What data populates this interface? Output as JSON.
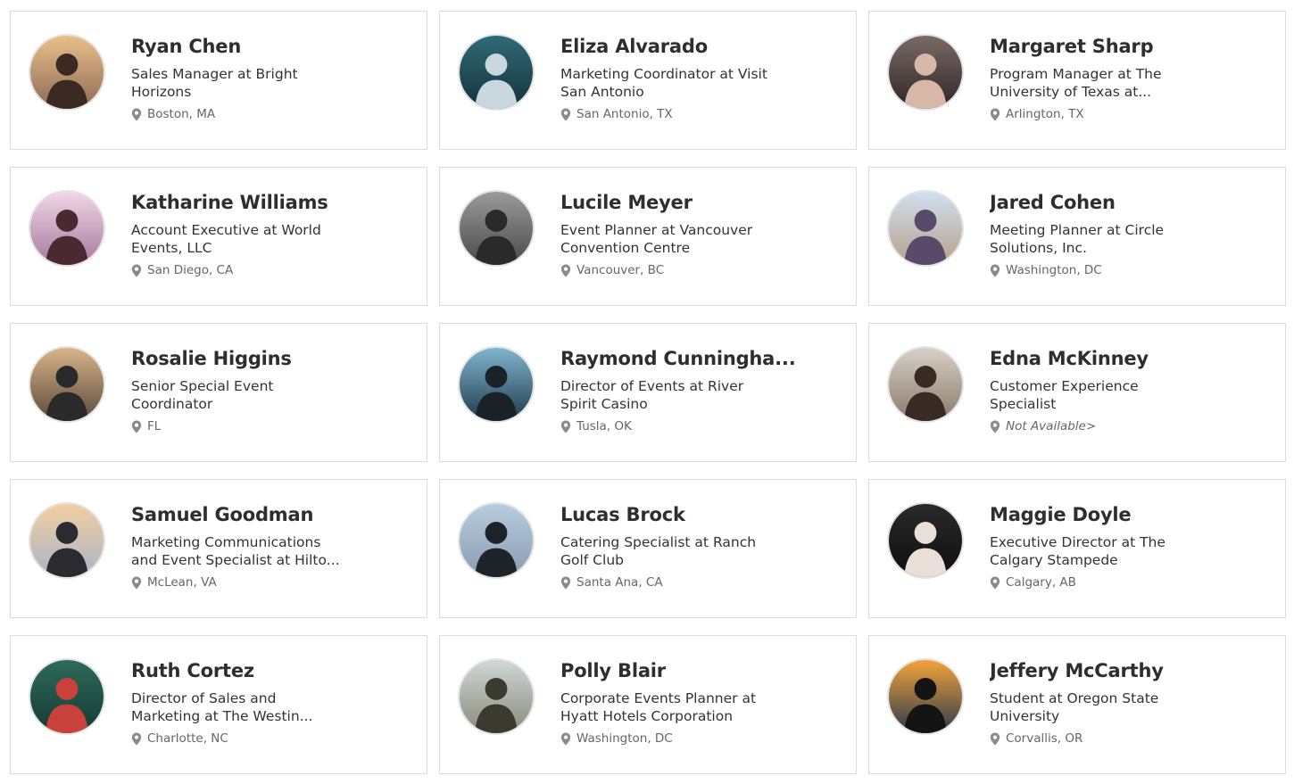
{
  "people": [
    {
      "name": "Ryan Chen",
      "title": "Sales Manager at Bright Horizons",
      "location": "Boston, MA",
      "avatar": {
        "bg1": "#e9c08a",
        "bg2": "#8d6a55",
        "fg": "#3b2a22"
      }
    },
    {
      "name": "Eliza Alvarado",
      "title": "Marketing Coordinator at Visit San Antonio",
      "location": "San Antonio, TX",
      "avatar": {
        "bg1": "#2f6a76",
        "bg2": "#15323c",
        "fg": "#c9d8de"
      }
    },
    {
      "name": "Margaret Sharp",
      "title": "Program Manager at The University of Texas at...",
      "location": "Arlington, TX",
      "avatar": {
        "bg1": "#7a6a66",
        "bg2": "#2e2624",
        "fg": "#d7b8a8"
      }
    },
    {
      "name": "Katharine Williams",
      "title": "Account Executive at World Events, LLC",
      "location": "San Diego, CA",
      "avatar": {
        "bg1": "#f0d6e8",
        "bg2": "#a57a9a",
        "fg": "#4a2a30"
      }
    },
    {
      "name": "Lucile Meyer",
      "title": "Event Planner at Vancouver Convention Centre",
      "location": "Vancouver, BC",
      "avatar": {
        "bg1": "#9a9a9a",
        "bg2": "#4a4a4a",
        "fg": "#2a2a2a"
      }
    },
    {
      "name": "Jared Cohen",
      "title": "Meeting Planner at Circle Solutions, Inc.",
      "location": "Washington, DC",
      "avatar": {
        "bg1": "#cfe0ef",
        "bg2": "#b8a08a",
        "fg": "#5a4a6a"
      }
    },
    {
      "name": "Rosalie Higgins",
      "title": "Senior Special Event Coordinator",
      "location": "FL",
      "avatar": {
        "bg1": "#d9b48a",
        "bg2": "#5a4a3a",
        "fg": "#2a2a2a"
      }
    },
    {
      "name": "Raymond Cunningha...",
      "title": "Director of Events at River Spirit Casino",
      "location": "Tusla, OK",
      "avatar": {
        "bg1": "#7fb5d0",
        "bg2": "#1f3a4a",
        "fg": "#1a2228"
      }
    },
    {
      "name": "Edna McKinney",
      "title": "Customer Experience Specialist",
      "location": "Not Available>",
      "location_na": true,
      "avatar": {
        "bg1": "#d8d0c8",
        "bg2": "#8a7a6a",
        "fg": "#3a2a24"
      }
    },
    {
      "name": "Samuel Goodman",
      "title": "Marketing Communications and Event Specialist at Hilto...",
      "location": "McLean, VA",
      "avatar": {
        "bg1": "#f2cfa0",
        "bg2": "#aab4c8",
        "fg": "#2a2a30"
      }
    },
    {
      "name": "Lucas Brock",
      "title": "Catering Specialist at Ranch Golf Club",
      "location": "Santa Ana, CA",
      "avatar": {
        "bg1": "#b8cde0",
        "bg2": "#8a9bb0",
        "fg": "#1e232a"
      }
    },
    {
      "name": "Maggie Doyle",
      "title": "Executive Director at The Calgary Stampede",
      "location": "Calgary, AB",
      "avatar": {
        "bg1": "#2a2a2a",
        "bg2": "#0e0e0e",
        "fg": "#e8e0d8"
      }
    },
    {
      "name": "Ruth Cortez",
      "title": "Director of Sales and Marketing at The Westin...",
      "location": "Charlotte, NC",
      "avatar": {
        "bg1": "#2e6a5a",
        "bg2": "#163a34",
        "fg": "#c8413a"
      }
    },
    {
      "name": "Polly Blair",
      "title": "Corporate Events Planner at Hyatt Hotels Corporation",
      "location": "Washington, DC",
      "avatar": {
        "bg1": "#cfd8d6",
        "bg2": "#8a8a7a",
        "fg": "#3a3a30"
      }
    },
    {
      "name": "Jeffery McCarthy",
      "title": "Student at Oregon State University",
      "location": "Corvallis, OR",
      "avatar": {
        "bg1": "#f2a33a",
        "bg2": "#2a3a4a",
        "fg": "#141414"
      }
    }
  ],
  "colors": {
    "border": "#dcdcdc",
    "name": "#2e2e2e",
    "title": "#333333",
    "location": "#666666",
    "pin": "#8a8a8a"
  },
  "icons": {
    "location": "map-pin-icon"
  }
}
